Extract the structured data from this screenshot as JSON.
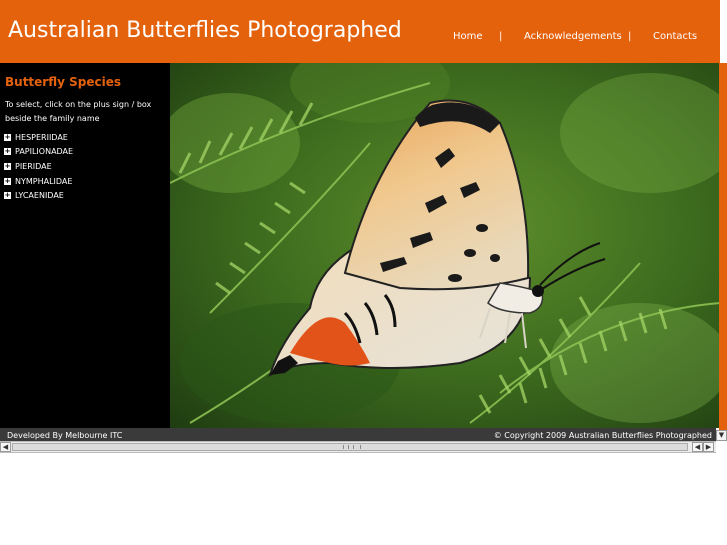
{
  "header": {
    "title": "Australian Butterflies Photographed",
    "nav": {
      "home": "Home",
      "sep1": "|",
      "acknowledgements": "Acknowledgements",
      "sep2": "|",
      "contacts": "Contacts"
    }
  },
  "sidebar": {
    "title": "Butterfly Species",
    "instructions": "To select, click on the plus sign / box beside the family name",
    "families": [
      {
        "label": "HESPERIIDAE",
        "icon": "plus-box-icon"
      },
      {
        "label": "PAPILIONADAE",
        "icon": "plus-box-icon"
      },
      {
        "label": "PIERIDAE",
        "icon": "plus-box-icon"
      },
      {
        "label": "NYMPHALIDAE",
        "icon": "plus-box-icon"
      },
      {
        "label": "LYCAENIDAE",
        "icon": "plus-box-icon"
      }
    ]
  },
  "photo": {
    "subject": "butterfly"
  },
  "footer": {
    "developed_by": "Developed By Melbourne ITC",
    "copyright": "© Copyright 2009 Australian Butterflies Photographed"
  },
  "colors": {
    "accent": "#e4620c",
    "sidebar_bg": "#000000",
    "footer_bg": "#3a3a3a"
  }
}
